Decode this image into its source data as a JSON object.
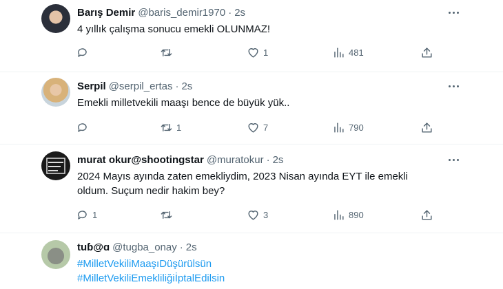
{
  "tweets": [
    {
      "name": "Barış Demir",
      "handle": "@baris_demir1970",
      "time": "2s",
      "text": "4 yıllık çalışma sonucu emekli OLUNMAZ!",
      "replies": "",
      "retweets": "",
      "likes": "1",
      "views": "481"
    },
    {
      "name": "Serpil",
      "handle": "@serpil_ertas",
      "time": "2s",
      "text": "Emekli milletvekili maaşı bence de büyük yük..",
      "replies": "",
      "retweets": "1",
      "likes": "7",
      "views": "790"
    },
    {
      "name": "murat okur@shootingstar",
      "handle": "@muratokur",
      "time": "2s",
      "text_line1": "2024 Mayıs ayında zaten emekliydim, 2023 Nisan ayında EYT ile emekli",
      "text_line2": "oldum. Suçum nedir hakim bey?",
      "replies": "1",
      "retweets": "",
      "likes": "3",
      "views": "890"
    },
    {
      "name": "tuɓ@ɑ",
      "handle": "@tugba_onay",
      "time": "2s",
      "hashtag1": "#MilletVekiliMaaşıDüşürülsün",
      "hashtag2": "#MilletVekiliEmekliliğiİptalEdilsin"
    }
  ],
  "dot": "·",
  "icons": [
    "reply-icon",
    "retweet-icon",
    "like-icon",
    "views-icon",
    "share-icon",
    "more-icon"
  ],
  "colors": {
    "link": "#1d9bf0",
    "muted": "#536471",
    "text": "#0f1419"
  }
}
